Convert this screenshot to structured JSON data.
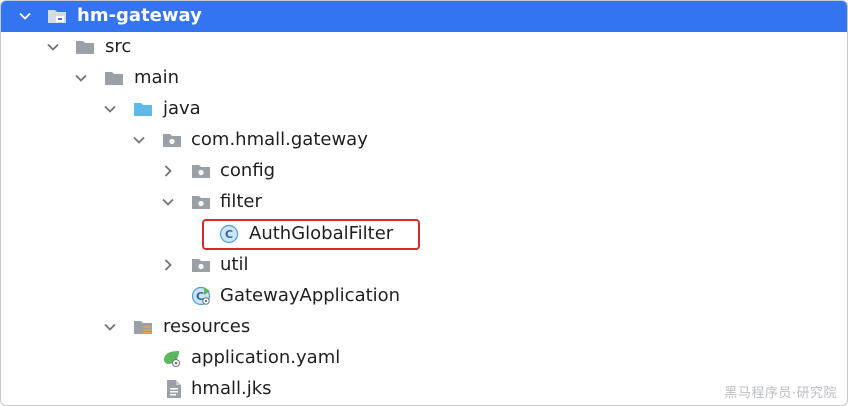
{
  "tree": {
    "root": {
      "label": "hm-gateway",
      "icon": "folder-module-icon"
    },
    "src": {
      "label": "src",
      "icon": "folder-icon"
    },
    "main": {
      "label": "main",
      "icon": "folder-icon"
    },
    "java": {
      "label": "java",
      "icon": "source-folder-icon"
    },
    "package": {
      "label": "com.hmall.gateway",
      "icon": "package-icon"
    },
    "config": {
      "label": "config",
      "icon": "package-icon"
    },
    "filter": {
      "label": "filter",
      "icon": "package-icon"
    },
    "auth_filter": {
      "label": "AuthGlobalFilter",
      "icon": "java-class-icon",
      "highlighted": true
    },
    "util": {
      "label": "util",
      "icon": "package-icon"
    },
    "gateway_app": {
      "label": "GatewayApplication",
      "icon": "spring-boot-class-icon"
    },
    "resources": {
      "label": "resources",
      "icon": "resources-folder-icon"
    },
    "application_yaml": {
      "label": "application.yaml",
      "icon": "spring-yaml-icon"
    },
    "hmall_jks": {
      "label": "hmall.jks",
      "icon": "file-icon"
    }
  },
  "watermark": "黑马程序员·研究院",
  "colors": {
    "selection": "#3574f0",
    "highlight_border": "#d62a2a",
    "folder": "#9aa0a6",
    "source_folder": "#5fb8e6",
    "class_icon": "#4a9fd8"
  }
}
